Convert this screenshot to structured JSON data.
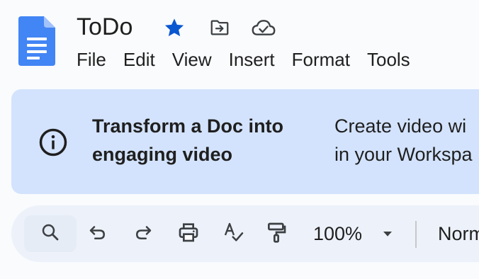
{
  "header": {
    "title": "ToDo",
    "icons": {
      "logo": "docs-logo",
      "star": "star-icon",
      "move": "move-to-folder-icon",
      "status": "cloud-saved-icon"
    }
  },
  "menu": {
    "items": [
      "File",
      "Edit",
      "View",
      "Insert",
      "Format",
      "Tools"
    ]
  },
  "banner": {
    "title_line1": "Transform a Doc into",
    "title_line2": "engaging video",
    "desc_line1": "Create video wi",
    "desc_line2": "in your Workspa",
    "icon": "info-icon"
  },
  "toolbar": {
    "zoom": "100%",
    "style": "Norm",
    "icons": [
      "search-icon",
      "undo-icon",
      "redo-icon",
      "print-icon",
      "spellcheck-icon",
      "paint-format-icon",
      "chevron-down-icon"
    ]
  },
  "colors": {
    "background": "#f9fbfd",
    "banner": "#d3e3fd",
    "toolbar": "#edf2fa",
    "star": "#0b57d0",
    "docs_blue": "#4285f4",
    "text": "#1f1f1f"
  }
}
